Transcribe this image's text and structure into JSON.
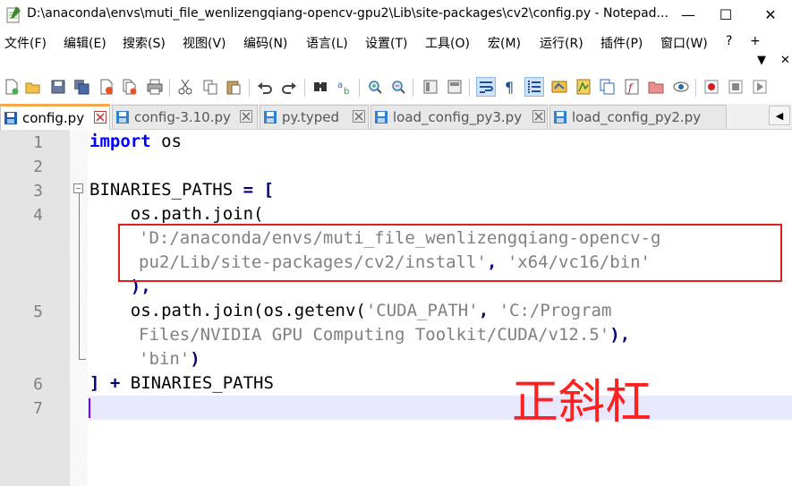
{
  "window": {
    "title": "D:\\anaconda\\envs\\muti_file_wenlizengqiang-opencv-gpu2\\Lib\\site-packages\\cv2\\config.py - Notepad...",
    "minimize": "—",
    "maximize": "☐",
    "close": "✕"
  },
  "menu": {
    "items": [
      "文件(F)",
      "编辑(E)",
      "搜索(S)",
      "视图(V)",
      "编码(N)",
      "语言(L)",
      "设置(T)",
      "工具(O)",
      "宏(M)",
      "运行(R)",
      "插件(P)",
      "窗口(W)",
      "?",
      "+"
    ],
    "overflow_down": "▼",
    "overflow_close": "✕"
  },
  "toolbar": {
    "icons": [
      "new-file",
      "open-file",
      "save",
      "save-all",
      "close",
      "close-all",
      "print",
      "cut",
      "copy",
      "paste",
      "undo",
      "redo",
      "find",
      "replace",
      "zoom-in",
      "zoom-out",
      "sync-v",
      "sync-h",
      "word-wrap",
      "show-all-chars",
      "indent-guide",
      "udl",
      "doc-map",
      "doc-list",
      "function-list",
      "folder-as-workspace",
      "monitoring",
      "record-macro",
      "stop-record",
      "play-macro"
    ]
  },
  "tabs": [
    {
      "label": "config.py",
      "active": true,
      "icon_color": "#1e5fb3"
    },
    {
      "label": "config-3.10.py",
      "active": false,
      "icon_color": "#2f80d0"
    },
    {
      "label": "py.typed",
      "active": false,
      "icon_color": "#2f80d0"
    },
    {
      "label": "load_config_py3.py",
      "active": false,
      "icon_color": "#2f80d0"
    },
    {
      "label": "load_config_py2.py",
      "active": false,
      "icon_color": "#2f80d0"
    }
  ],
  "tab_scroll_left": "◀",
  "editor": {
    "line_numbers": [
      "1",
      "2",
      "3",
      "4",
      "5",
      "6",
      "7"
    ],
    "code": {
      "l1_kw": "import",
      "l1_rest": " os",
      "l3_name": "BINARIES_PATHS",
      "l3_op": " = [",
      "l4": "    os.path.join(",
      "l4_str1": "'D:/anaconda/envs/muti_file_wenlizengqiang-opencv-g",
      "l4_str2": "pu2/Lib/site-packages/cv2/install'",
      "l4_sep": ", ",
      "l4_str3": "'x64/vc16/bin'",
      "l4_close": "    ),",
      "l5_a": "    os.path.join(os.getenv(",
      "l5_str1": "'CUDA_PATH'",
      "l5_sep": ", ",
      "l5_str2a": "'C:/Program",
      "l5_str2b": "Files/NVIDIA GPU Computing Toolkit/CUDA/v12.5'",
      "l5_close1": "),",
      "l5_str3": "'bin'",
      "l5_close2": ")",
      "l6_op": "] + ",
      "l6_name": "BINARIES_PATHS"
    }
  },
  "annotation": {
    "text": "正斜杠",
    "color": "#ff2020"
  }
}
